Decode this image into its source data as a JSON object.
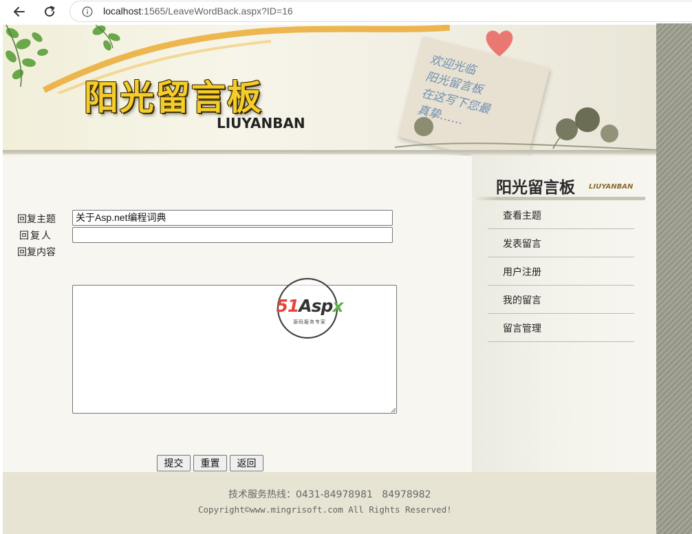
{
  "browser": {
    "url_host": "localhost",
    "url_rest": ":1565/LeaveWordBack.aspx?ID=16"
  },
  "banner": {
    "title": "阳光留言板",
    "subtitle": "LIUYANBAN",
    "note_text": "欢迎光临\n阳光留言板\n在这写下您最\n真挚……"
  },
  "form": {
    "subject_label": "回复主题",
    "replier_label": "回复人",
    "content_label": "回复内容",
    "subject_value": "关于Asp.net编程词典",
    "replier_value": "",
    "content_value": "",
    "submit_label": "提交",
    "reset_label": "重置",
    "back_label": "返回"
  },
  "watermark": {
    "brand_a": "51",
    "brand_b": "Asp",
    "brand_c": "x",
    "tagline": "源码服务专家"
  },
  "sidebar": {
    "title": "阳光留言板",
    "subtitle": "LIUYANBAN",
    "items": [
      {
        "label": "查看主题"
      },
      {
        "label": "发表留言"
      },
      {
        "label": "用户注册"
      },
      {
        "label": "我的留言"
      },
      {
        "label": "留言管理"
      }
    ]
  },
  "footer": {
    "hotline": "技术服务热线：0431-84978981   84978982",
    "copyright": "Copyright©www.mingrisoft.com All Rights Reserved!"
  },
  "colors": {
    "banner_title": "#f4cd2a",
    "page_bg": "#f7f6f0",
    "footer_bg": "#e7e4d3",
    "stripe": "#9b9c8c"
  }
}
